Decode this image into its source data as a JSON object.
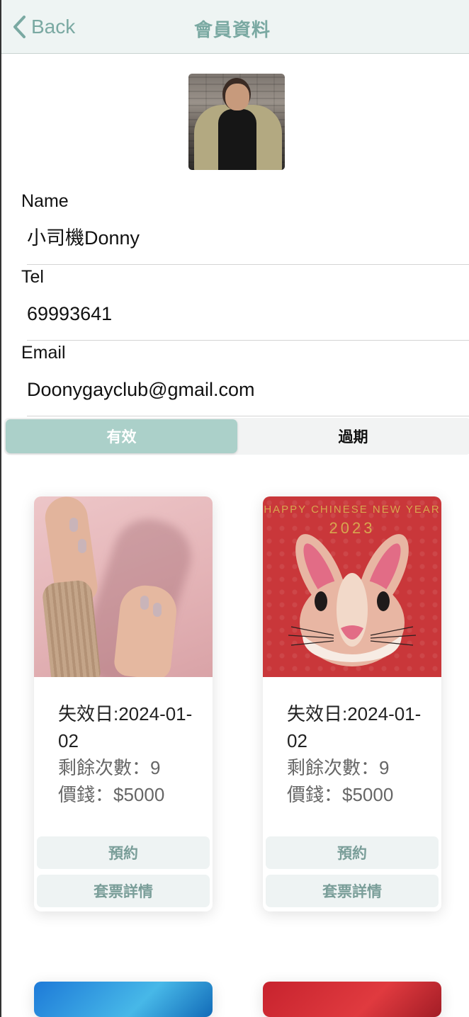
{
  "nav": {
    "back_label": "Back",
    "title": "會員資料"
  },
  "profile": {
    "name_label": "Name",
    "name_value": "小司機Donny",
    "tel_label": "Tel",
    "tel_value": "69993641",
    "email_label": "Email",
    "email_value": "Doonygayclub@gmail.com"
  },
  "tabs": {
    "active": "有效",
    "inactive": "過期"
  },
  "cards": [
    {
      "image": "hands-with-manicured-nails",
      "expiry": "失效日:2024-01-02",
      "remaining": "剩餘次數：9",
      "price": "價錢：$5000",
      "book_label": "預約",
      "detail_label": "套票詳情"
    },
    {
      "image": "rabbit-chinese-new-year",
      "image_text_top": "HAPPY CHINESE NEW YEAR",
      "image_text_year": "2023",
      "expiry": "失效日:2024-01-02",
      "remaining": "剩餘次數：9",
      "price": "價錢：$5000",
      "book_label": "預約",
      "detail_label": "套票詳情"
    }
  ],
  "colors": {
    "accent": "#7aa9a2",
    "segment_active": "#abd0c9",
    "navbar_bg": "#eef4f3"
  }
}
